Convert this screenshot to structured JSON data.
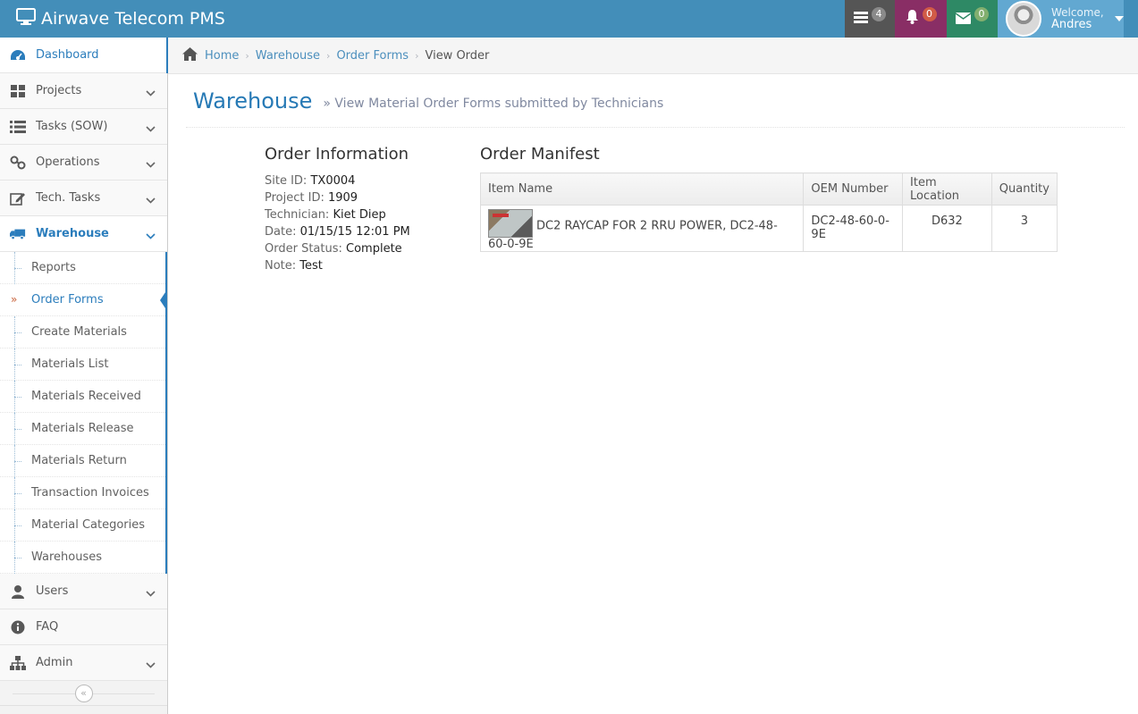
{
  "app": {
    "title": "Airwave Telecom PMS"
  },
  "navbar": {
    "tasks_count": "4",
    "notifications_count": "0",
    "messages_count": "0",
    "welcome": "Welcome,",
    "username": "Andres"
  },
  "sidebar": {
    "items": [
      {
        "label": "Dashboard",
        "icon": "dashboard-icon"
      },
      {
        "label": "Projects",
        "icon": "grid-icon"
      },
      {
        "label": "Tasks (SOW)",
        "icon": "list-icon"
      },
      {
        "label": "Operations",
        "icon": "link-icon"
      },
      {
        "label": "Tech. Tasks",
        "icon": "edit-icon"
      },
      {
        "label": "Warehouse",
        "icon": "truck-icon"
      },
      {
        "label": "Users",
        "icon": "user-icon"
      },
      {
        "label": "FAQ",
        "icon": "info-icon"
      },
      {
        "label": "Admin",
        "icon": "sitemap-icon"
      }
    ],
    "warehouse_sub": [
      "Reports",
      "Order Forms",
      "Create Materials",
      "Materials List",
      "Materials Received",
      "Materials Release",
      "Materials Return",
      "Transaction Invoices",
      "Material Categories",
      "Warehouses"
    ]
  },
  "breadcrumb": {
    "home": "Home",
    "warehouse": "Warehouse",
    "order_forms": "Order Forms",
    "current": "View Order"
  },
  "page": {
    "title": "Warehouse",
    "subtitle": "» View Material Order Forms submitted by Technicians"
  },
  "order_info": {
    "title": "Order Information",
    "site_id_label": "Site ID:",
    "site_id": "TX0004",
    "project_id_label": "Project ID:",
    "project_id": "1909",
    "technician_label": "Technician:",
    "technician": "Kiet Diep",
    "date_label": "Date:",
    "date": "01/15/15 12:01 PM",
    "status_label": "Order Status:",
    "status": "Complete",
    "note_label": "Note:",
    "note": "Test"
  },
  "manifest": {
    "title": "Order Manifest",
    "columns": [
      "Item Name",
      "OEM Number",
      "Item Location",
      "Quantity"
    ],
    "rows": [
      {
        "name": "DC2 RAYCAP FOR 2 RRU POWER, DC2-48-60-0-9E",
        "oem": "DC2-48-60-0-9E",
        "location": "D632",
        "quantity": "3"
      }
    ]
  }
}
